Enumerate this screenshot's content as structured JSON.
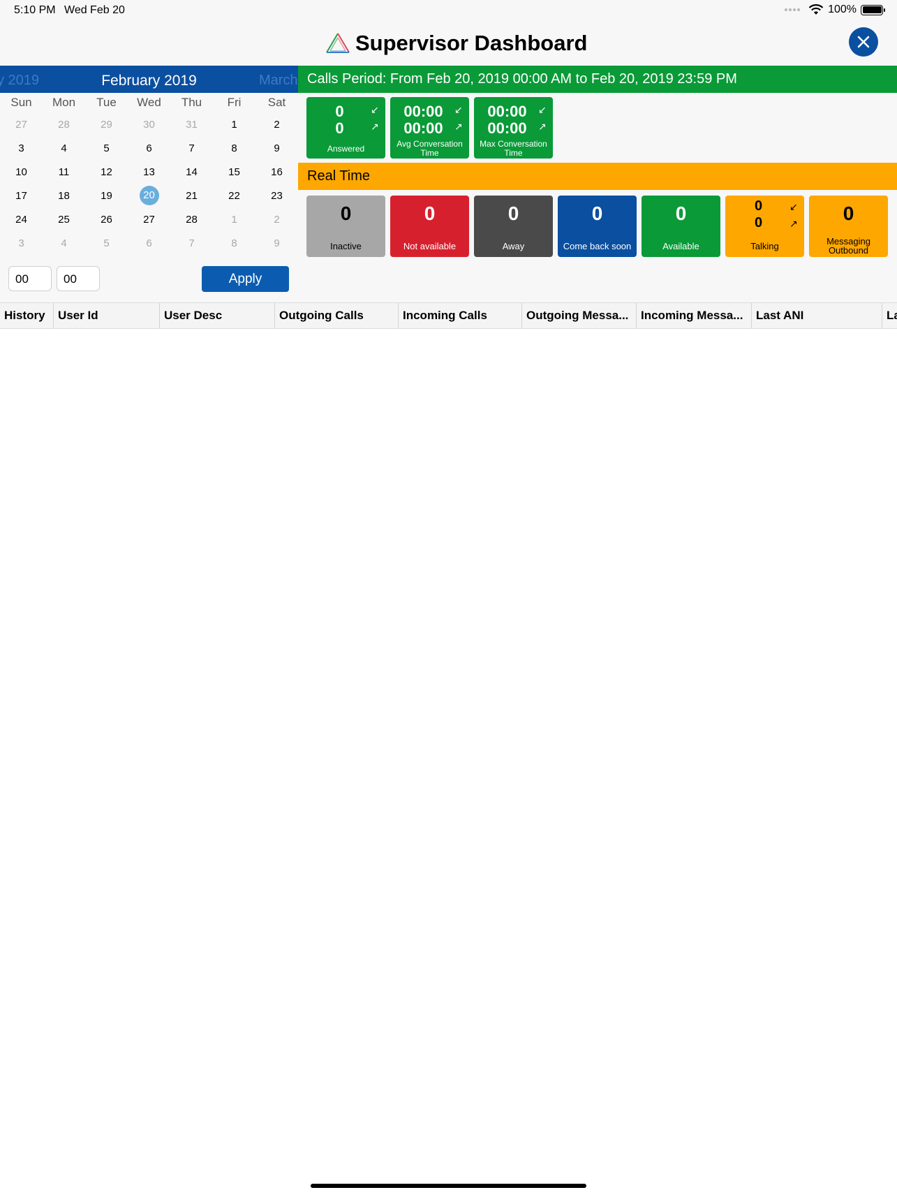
{
  "status_bar": {
    "time": "5:10 PM",
    "date": "Wed Feb 20",
    "battery": "100%"
  },
  "header": {
    "title": "Supervisor Dashboard"
  },
  "calendar": {
    "prev_label": "y 2019",
    "current_month": "February 2019",
    "next_label": "March",
    "weekdays": [
      "Sun",
      "Mon",
      "Tue",
      "Wed",
      "Thu",
      "Fri",
      "Sat"
    ],
    "weeks": [
      [
        "27",
        "28",
        "29",
        "30",
        "31",
        "1",
        "2"
      ],
      [
        "3",
        "4",
        "5",
        "6",
        "7",
        "8",
        "9"
      ],
      [
        "10",
        "11",
        "12",
        "13",
        "14",
        "15",
        "16"
      ],
      [
        "17",
        "18",
        "19",
        "20",
        "21",
        "22",
        "23"
      ],
      [
        "24",
        "25",
        "26",
        "27",
        "28",
        "1",
        "2"
      ],
      [
        "3",
        "4",
        "5",
        "6",
        "7",
        "8",
        "9"
      ]
    ],
    "selected_day": "20",
    "hour_value": "00",
    "minute_value": "00",
    "apply_label": "Apply"
  },
  "calls_period": {
    "banner": "Calls Period: From Feb 20, 2019 00:00 AM to Feb 20, 2019 23:59 PM",
    "tiles": [
      {
        "incoming": "0",
        "outgoing": "0",
        "label": "Answered"
      },
      {
        "incoming": "00:00",
        "outgoing": "00:00",
        "label": "Avg Conversation Time"
      },
      {
        "incoming": "00:00",
        "outgoing": "00:00",
        "label": "Max Conversation Time"
      }
    ]
  },
  "real_time": {
    "banner": "Real Time",
    "inactive": {
      "value": "0",
      "label": "Inactive"
    },
    "not_available": {
      "value": "0",
      "label": "Not available"
    },
    "away": {
      "value": "0",
      "label": "Away"
    },
    "come_back_soon": {
      "value": "0",
      "label": "Come back soon"
    },
    "available": {
      "value": "0",
      "label": "Available"
    },
    "talking": {
      "incoming": "0",
      "outgoing": "0",
      "label": "Talking"
    },
    "messaging_outbound": {
      "value": "0",
      "label": "Messaging Outbound"
    }
  },
  "table": {
    "columns": [
      "History",
      "User Id",
      "User Desc",
      "Outgoing Calls",
      "Incoming Calls",
      "Outgoing Messa...",
      "Incoming Messa...",
      "Last ANI",
      "La"
    ]
  },
  "colors": {
    "brand_blue": "#0b4fa0",
    "green": "#0a9a38",
    "orange": "#fea700",
    "red": "#d7202e",
    "selected_day": "#6aaede"
  }
}
